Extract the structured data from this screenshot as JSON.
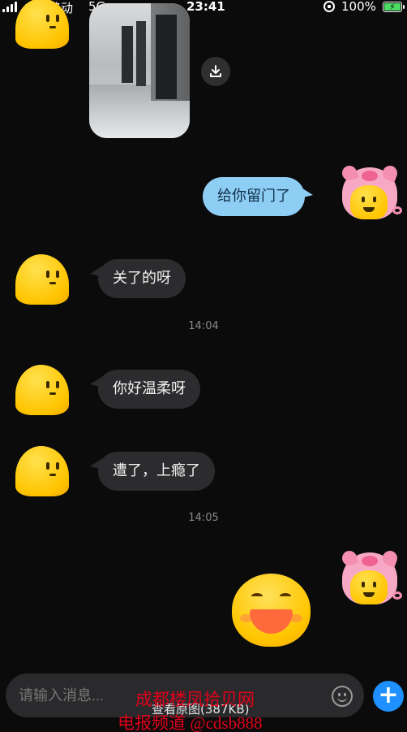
{
  "status_bar": {
    "carrier": "中国移动",
    "network": "5G",
    "time": "23:41",
    "battery": "100%"
  },
  "messages": [
    {
      "id": "m1",
      "direction": "out",
      "text": "给你留门了"
    },
    {
      "id": "m2",
      "direction": "in",
      "text": "关了的呀"
    },
    {
      "id": "m3",
      "direction": "in",
      "text": "你好温柔呀"
    },
    {
      "id": "m4",
      "direction": "in",
      "text": "遭了，上瘾了"
    }
  ],
  "timestamps": [
    "14:04",
    "14:05"
  ],
  "composer": {
    "placeholder": "请输入消息..."
  },
  "view_original_label": "查看原图(387KB)",
  "watermark": {
    "line1": "成都楼凤拾贝网",
    "line2": "电报频道 @cdsb888"
  },
  "colors": {
    "background": "#0b0b0b",
    "incoming_bubble": "#2c2c2e",
    "outgoing_bubble": "#8ecdf4",
    "accent": "#1e90ff",
    "watermark": "#e0001b"
  },
  "icons": [
    "signal-icon",
    "lock-rotation-icon",
    "battery-icon",
    "download-icon",
    "emoji-icon",
    "plus-icon"
  ]
}
